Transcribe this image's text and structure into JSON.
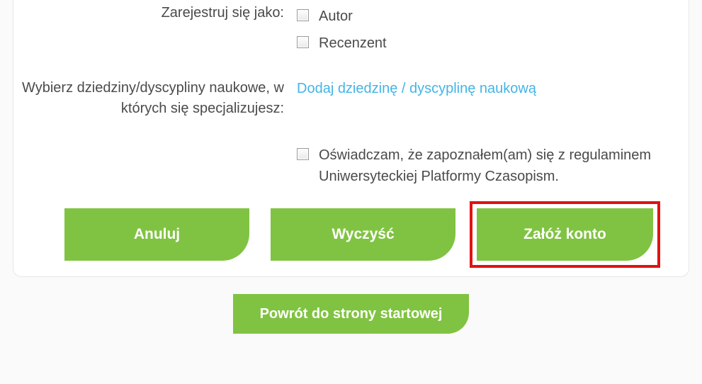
{
  "form": {
    "register_as": {
      "label": "Zarejestruj się jako:",
      "options": {
        "author": "Autor",
        "reviewer": "Recenzent"
      }
    },
    "disciplines": {
      "label": "Wybierz dziedziny/dyscypliny naukowe, w których się specjalizujesz:",
      "link_text": "Dodaj dziedzinę / dyscyplinę naukową"
    },
    "terms_text": "Oświadczam, że zapoznałem(am) się z regulaminem Uniwersyteckiej Platformy Czasopism."
  },
  "buttons": {
    "cancel": "Anuluj",
    "clear": "Wyczyść",
    "create": "Załóż konto",
    "back": "Powrót do strony startowej"
  },
  "colors": {
    "accent_green": "#80c342",
    "link_blue": "#43b5e6",
    "highlight_red": "#e01212"
  }
}
